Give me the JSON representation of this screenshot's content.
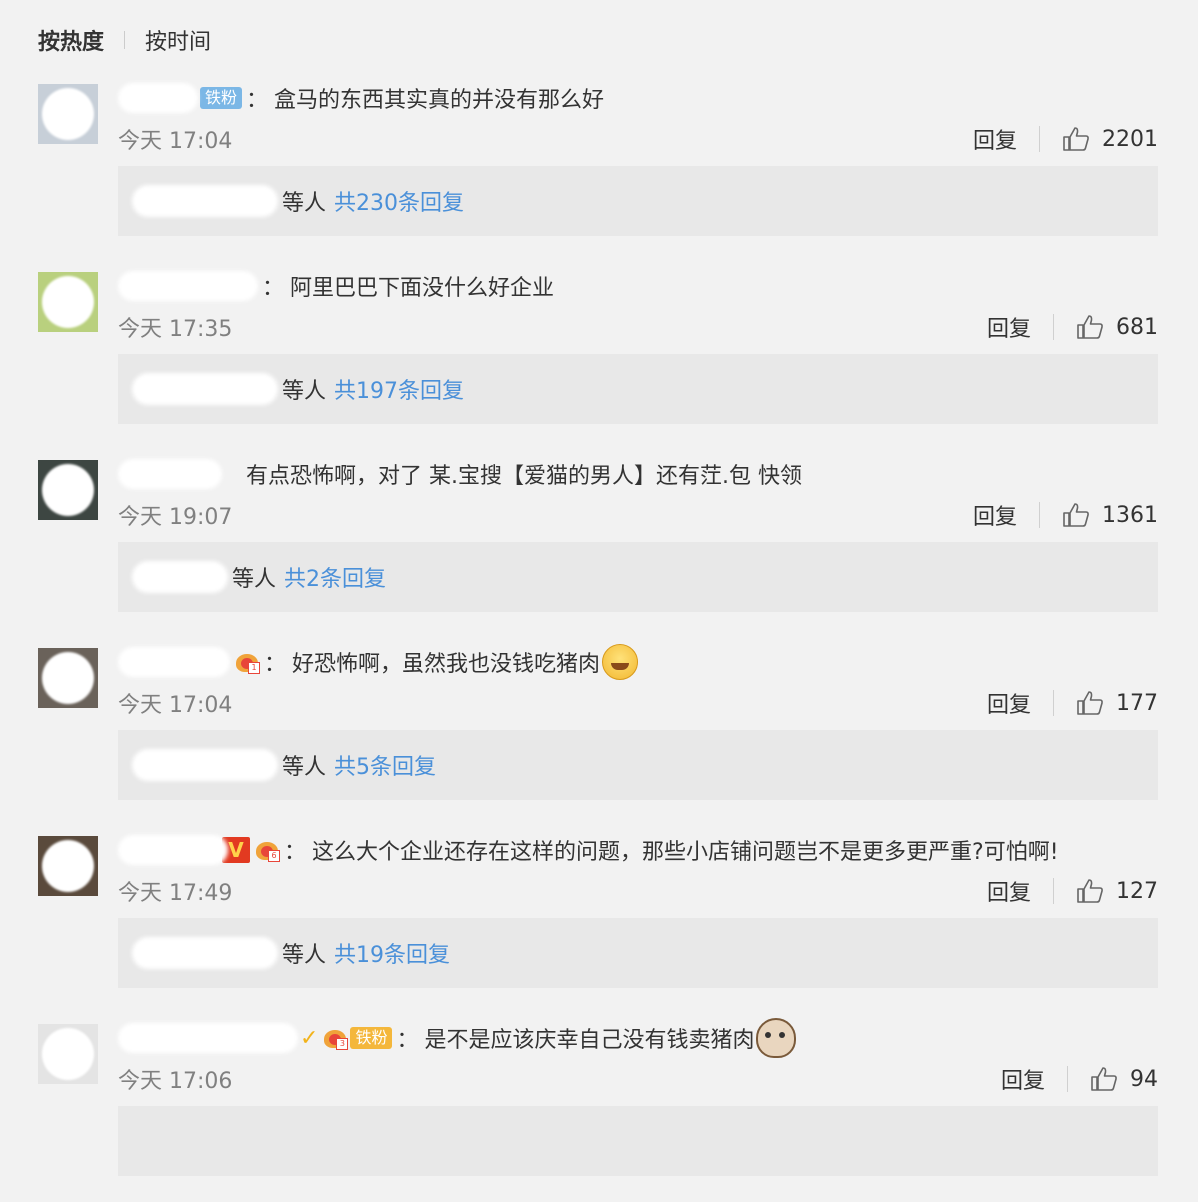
{
  "sort": {
    "hot": "按热度",
    "time": "按时间"
  },
  "reply_label": "回复",
  "others_label": "等人",
  "comments": [
    {
      "badge": "铁粉",
      "text": "盒马的东西其实真的并没有那么好",
      "time": "今天 17:04",
      "likes": "2201",
      "reply_summary": "共230条回复"
    },
    {
      "text": "阿里巴巴下面没什么好企业",
      "time": "今天 17:35",
      "likes": "681",
      "reply_summary": "共197条回复"
    },
    {
      "text": "有点恐怖啊，对了 某.宝搜【爱猫的男人】还有茳.包 快领",
      "time": "今天 19:07",
      "likes": "1361",
      "reply_summary": "共2条回复"
    },
    {
      "text": "好恐怖啊，虽然我也没钱吃猪肉",
      "time": "今天 17:04",
      "likes": "177",
      "reply_summary": "共5条回复",
      "emoji": "laughing-tears-emoji"
    },
    {
      "text": "这么大个企业还存在这样的问题，那些小店铺问题岂不是更多更严重?可怕啊!",
      "time": "今天 17:49",
      "likes": "127",
      "reply_summary": "共19条回复",
      "crown_level": "6"
    },
    {
      "badge": "铁粉",
      "text": "是不是应该庆幸自己没有钱卖猪肉",
      "time": "今天 17:06",
      "likes": "94",
      "emoji": "cat-face-emoji",
      "crown_level": "3"
    }
  ],
  "colors": {
    "link": "#4a90d9",
    "background": "#f2f2f2",
    "reply_box": "#e8e8e8"
  }
}
